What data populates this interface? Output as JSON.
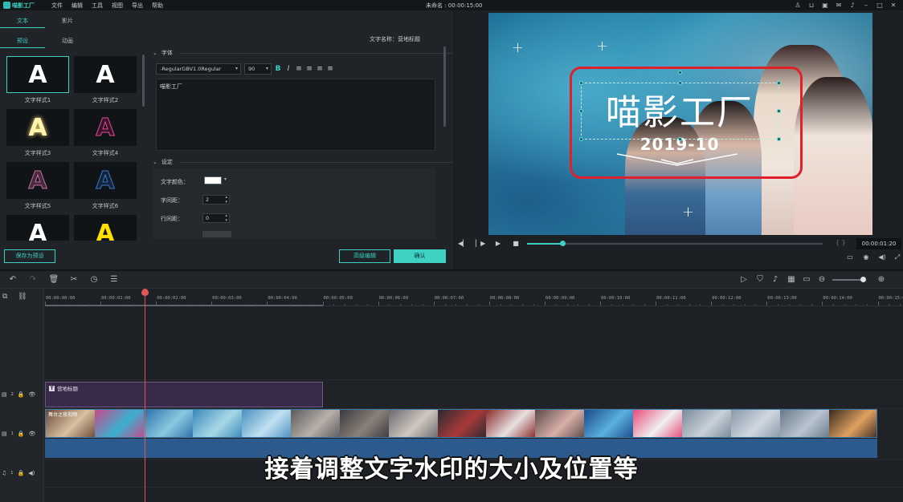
{
  "app": {
    "logo_text": "喵影工厂",
    "menu": [
      "文件",
      "编辑",
      "工具",
      "视图",
      "导出",
      "帮助"
    ],
    "doc_title": "未命名 : 00:00:15:00"
  },
  "left_panel": {
    "top_tabs": [
      "文本",
      "影片"
    ],
    "sub_tabs": [
      "预设",
      "动画"
    ],
    "styles": [
      {
        "label": "文字样式1",
        "color": "#ffffff"
      },
      {
        "label": "文字样式2",
        "color": "#ffffff"
      },
      {
        "label": "文字样式3",
        "color": "#fff4b0"
      },
      {
        "label": "文字样式4",
        "color": "#3a1030"
      },
      {
        "label": "文字样式5",
        "color": "#4a2a40"
      },
      {
        "label": "文字样式6",
        "color": "#12233a"
      },
      {
        "label": "",
        "color": "#ffffff"
      },
      {
        "label": "",
        "color": "#ffe000"
      }
    ],
    "style_glyph": "A",
    "text_name": "文字名称：营地标题",
    "font_section": "字体",
    "font_family": "-RegularGBV1.0Regular",
    "font_size": "90",
    "fmt_buttons": [
      "B",
      "I",
      "≡",
      "≡",
      "≡",
      "≡"
    ],
    "text_content": "喵影工厂",
    "settings_section": "设定",
    "text_color_label": "文字颜色：",
    "letter_spacing_label": "字间距：",
    "letter_spacing_value": "2",
    "line_spacing_label": "行间距：",
    "line_spacing_value": "0",
    "save_preset": "保存为预设",
    "advanced_edit": "高级编辑",
    "confirm": "确认"
  },
  "preview": {
    "title_text": "喵影工厂",
    "date_text": "2019-10",
    "timecode": "00:00:01:20",
    "seek_progress": 0.12
  },
  "timeline": {
    "ruler_labels": [
      "00:00:00:00",
      "00:00:01:00",
      "00:00:02:00",
      "00:00:03:00",
      "00:00:04:00",
      "00:00:05:00",
      "00:00:06:00",
      "00:00:07:00",
      "00:00:08:00",
      "00:00:09:00",
      "00:00:10:00",
      "00:00:11:00",
      "00:00:12:00",
      "00:00:13:00",
      "00:00:14:00",
      "00:00:15:0"
    ],
    "title_clip_label": "营地标题",
    "video_clip_label": "舞台之夜视频",
    "track_labels": [
      "2",
      "1",
      "1"
    ],
    "subtitle": "接着调整文字水印的大小及位置等"
  },
  "colors": {
    "accent": "#3fd0c4",
    "selection_red": "#e0202a",
    "playhead": "#e0555a"
  }
}
